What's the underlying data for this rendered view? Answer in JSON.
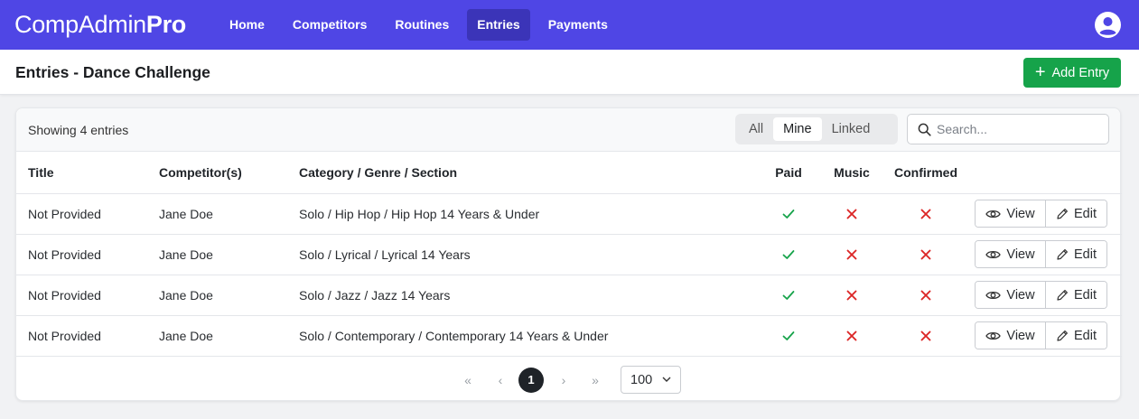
{
  "brand": {
    "name_regular": "CompAdmin",
    "name_bold": "Pro"
  },
  "nav": {
    "items": [
      {
        "label": "Home",
        "active": false
      },
      {
        "label": "Competitors",
        "active": false
      },
      {
        "label": "Routines",
        "active": false
      },
      {
        "label": "Entries",
        "active": true
      },
      {
        "label": "Payments",
        "active": false
      }
    ],
    "user_icon": "user-circle-icon"
  },
  "header": {
    "title": "Entries - Dance Challenge",
    "add_button": "Add Entry"
  },
  "toolbar": {
    "showing_text": "Showing 4 entries",
    "filters": [
      {
        "label": "All",
        "active": false
      },
      {
        "label": "Mine",
        "active": true
      },
      {
        "label": "Linked",
        "active": false
      }
    ],
    "search_placeholder": "Search..."
  },
  "table": {
    "columns": [
      "Title",
      "Competitor(s)",
      "Category / Genre / Section",
      "Paid",
      "Music",
      "Confirmed",
      ""
    ],
    "rows": [
      {
        "title": "Not Provided",
        "competitor": "Jane Doe",
        "category": "Solo / Hip Hop / Hip Hop 14 Years & Under",
        "paid": true,
        "music": false,
        "confirmed": false,
        "view": "View",
        "edit": "Edit"
      },
      {
        "title": "Not Provided",
        "competitor": "Jane Doe",
        "category": "Solo / Lyrical / Lyrical 14 Years",
        "paid": true,
        "music": false,
        "confirmed": false,
        "view": "View",
        "edit": "Edit"
      },
      {
        "title": "Not Provided",
        "competitor": "Jane Doe",
        "category": "Solo / Jazz / Jazz 14 Years",
        "paid": true,
        "music": false,
        "confirmed": false,
        "view": "View",
        "edit": "Edit"
      },
      {
        "title": "Not Provided",
        "competitor": "Jane Doe",
        "category": "Solo / Contemporary / Contemporary 14 Years & Under",
        "paid": true,
        "music": false,
        "confirmed": false,
        "view": "View",
        "edit": "Edit"
      }
    ]
  },
  "pagination": {
    "first": "«",
    "prev": "‹",
    "current_page": "1",
    "next": "›",
    "last": "»",
    "page_size": "100"
  },
  "colors": {
    "navbar": "#4f46e5",
    "nav_active": "#3b34b8",
    "add_button": "#16a34a",
    "check": "#16a34a",
    "cross": "#dc2626"
  }
}
